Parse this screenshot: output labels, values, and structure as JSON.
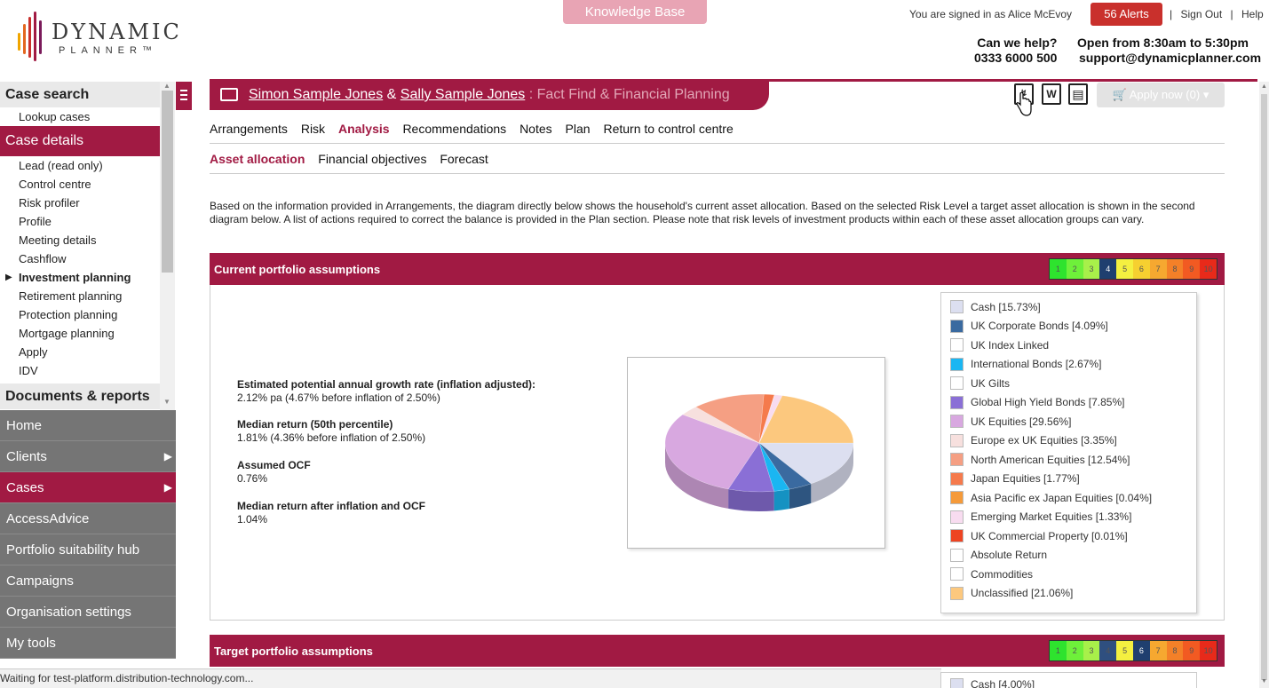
{
  "header": {
    "logo_text": "DYNAMIC",
    "logo_subtext": "PLANNER™",
    "knowledge_base": "Knowledge Base",
    "signed_in": "You are signed in as Alice McEvoy",
    "alerts": "56 Alerts",
    "sign_out": "Sign Out",
    "help": "Help",
    "help_question": "Can we help?",
    "phone": "0333 6000 500",
    "hours": "Open from 8:30am to 5:30pm",
    "email": "support@dynamicplanner.com"
  },
  "sidebar": {
    "case_search": "Case search",
    "lookup_cases": "Lookup cases",
    "case_details": "Case details",
    "items": [
      "Lead (read only)",
      "Control centre",
      "Risk profiler",
      "Profile",
      "Meeting details",
      "Cashflow",
      "Investment planning",
      "Retirement planning",
      "Protection planning",
      "Mortgage planning",
      "Apply",
      "IDV"
    ],
    "documents": "Documents & reports",
    "nav": [
      "Home",
      "Clients",
      "Cases",
      "AccessAdvice",
      "Portfolio suitability hub",
      "Campaigns",
      "Organisation settings",
      "My tools"
    ]
  },
  "status_bar": "Waiting for test-platform.distribution-technology.com...",
  "case": {
    "client1": "Simon Sample Jones",
    "amp": "&",
    "client2": "Sally Sample Jones",
    "subtitle": ": Fact Find & Financial Planning",
    "apply_now": "Apply now (0)"
  },
  "icons": {
    "pdf": "pdf-export-icon",
    "word": "W",
    "save": "save-icon"
  },
  "main_tabs": [
    "Arrangements",
    "Risk",
    "Analysis",
    "Recommendations",
    "Notes",
    "Plan",
    "Return to control centre"
  ],
  "sub_tabs": [
    "Asset allocation",
    "Financial objectives",
    "Forecast"
  ],
  "intro": "Based on the information provided in Arrangements, the diagram directly below shows the household's current asset allocation. Based on the selected Risk Level a target asset allocation is shown in the second diagram below. A list of actions required to correct the balance is provided in the Plan section. Please note that risk levels of investment products within each of these asset allocation groups can vary.",
  "current_panel": {
    "title": "Current portfolio assumptions",
    "risk_levels": [
      "1",
      "2",
      "3",
      "4",
      "5",
      "6",
      "7",
      "8",
      "9",
      "10"
    ],
    "selected_risk": 4,
    "stats": [
      {
        "label": "Estimated potential annual growth rate (inflation adjusted):",
        "value": "2.12% pa (4.67% before inflation of 2.50%)"
      },
      {
        "label": "Median return (50th percentile)",
        "value": "1.81% (4.36% before inflation of 2.50%)"
      },
      {
        "label": "Assumed OCF",
        "value": "0.76%"
      },
      {
        "label": "Median return after inflation and OCF",
        "value": "1.04%"
      }
    ],
    "legend": [
      {
        "label": "Cash [15.73%]",
        "color": "#dcdff0"
      },
      {
        "label": "UK Corporate Bonds [4.09%]",
        "color": "#3a6aa0"
      },
      {
        "label": "UK Index Linked",
        "color": "#ffffff"
      },
      {
        "label": "International Bonds [2.67%]",
        "color": "#1ab6f2"
      },
      {
        "label": "UK Gilts",
        "color": "#ffffff"
      },
      {
        "label": "Global High Yield Bonds [7.85%]",
        "color": "#8a6fd6"
      },
      {
        "label": "UK Equities [29.56%]",
        "color": "#d8a8e0"
      },
      {
        "label": "Europe ex UK Equities [3.35%]",
        "color": "#f7e0de"
      },
      {
        "label": "North American Equities [12.54%]",
        "color": "#f59f83"
      },
      {
        "label": "Japan Equities [1.77%]",
        "color": "#f57a4c"
      },
      {
        "label": "Asia Pacific ex Japan Equities [0.04%]",
        "color": "#f59a3a"
      },
      {
        "label": "Emerging Market Equities [1.33%]",
        "color": "#f8dcf0"
      },
      {
        "label": "UK Commercial Property [0.01%]",
        "color": "#ee4422"
      },
      {
        "label": "Absolute Return",
        "color": "#ffffff"
      },
      {
        "label": "Commodities",
        "color": "#ffffff"
      },
      {
        "label": "Unclassified [21.06%]",
        "color": "#fcc87e"
      }
    ]
  },
  "chart_data": {
    "type": "pie",
    "categories": [
      "Cash",
      "UK Corporate Bonds",
      "International Bonds",
      "Global High Yield Bonds",
      "UK Equities",
      "Europe ex UK Equities",
      "North American Equities",
      "Japan Equities",
      "Asia Pacific ex Japan Equities",
      "Emerging Market Equities",
      "UK Commercial Property",
      "Unclassified"
    ],
    "values": [
      15.73,
      4.09,
      2.67,
      7.85,
      29.56,
      3.35,
      12.54,
      1.77,
      0.04,
      1.33,
      0.01,
      21.06
    ],
    "colors": [
      "#dcdff0",
      "#3a6aa0",
      "#1ab6f2",
      "#8a6fd6",
      "#d8a8e0",
      "#f7e0de",
      "#f59f83",
      "#f57a4c",
      "#f59a3a",
      "#f8dcf0",
      "#ee4422",
      "#fcc87e"
    ]
  },
  "target_panel": {
    "title": "Target portfolio assumptions",
    "risk_levels": [
      "1",
      "2",
      "3",
      "4",
      "5",
      "6",
      "7",
      "8",
      "9",
      "10"
    ],
    "selected_risk": 6,
    "legend_first": "Cash [4.00%]"
  }
}
